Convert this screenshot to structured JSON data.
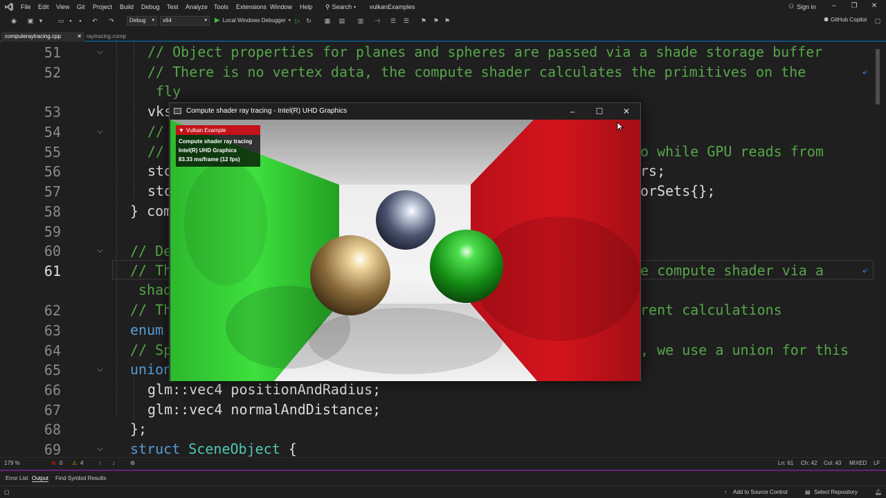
{
  "menubar": {
    "items": [
      "File",
      "Edit",
      "View",
      "Git",
      "Project",
      "Build",
      "Debug",
      "Test",
      "Analyze",
      "Tools",
      "Extensions",
      "Window",
      "Help"
    ],
    "search_label": "Search",
    "solution_name": "vulkanExamples",
    "sign_in": "Sign in"
  },
  "toolbar": {
    "configuration": "Debug",
    "platform": "x64",
    "debugger_label": "Local Windows Debugger",
    "copilot_label": "GitHub Copilot"
  },
  "tabs": [
    {
      "label": "computeraytracing.cpp",
      "active": true
    },
    {
      "label": "raytracing.comp",
      "active": false
    }
  ],
  "editor": {
    "lines": [
      {
        "num": "51",
        "text": "// Object properties for planes and spheres are passed via a shade storage buffer"
      },
      {
        "num": "52",
        "text": "// There is no vertex data, the compute shader calculates the primitives on the"
      },
      {
        "num": "",
        "text": "fly"
      },
      {
        "num": "53",
        "text": "vks"
      },
      {
        "num": "54",
        "text": "//"
      },
      {
        "num": "55",
        "text": "//"
      },
      {
        "num": "56",
        "text": "sto"
      },
      {
        "num": "57",
        "text": "sto"
      },
      {
        "num": "58",
        "text": "} com"
      },
      {
        "num": "59",
        "text": ""
      },
      {
        "num": "60",
        "text": "// De"
      },
      {
        "num": "61",
        "text": "// Th"
      },
      {
        "num": "",
        "text": "shad"
      },
      {
        "num": "62",
        "text": "// Th"
      },
      {
        "num": "63",
        "text": "enum "
      },
      {
        "num": "64",
        "text": "// Sp"
      },
      {
        "num": "65",
        "text": "union"
      },
      {
        "num": "66",
        "text": "glm::vec4 positionAndRadius;"
      },
      {
        "num": "67",
        "text": "glm::vec4 normalAndDistance;"
      },
      {
        "num": "68",
        "text": "};"
      },
      {
        "num": "69",
        "text": "struct SceneObject {"
      }
    ],
    "right_fragments": {
      "line55": "o while GPU reads from",
      "line56": "rs;",
      "line57": "orSets{};",
      "line61": "e compute shader via a",
      "line62": "rent calculations",
      "line64": ", we use a union for this"
    },
    "current_line": "61"
  },
  "editor_status": {
    "zoom": "179 %",
    "errors": "0",
    "warnings": "4",
    "line": "Ln: 61",
    "char": "Ch: 42",
    "col": "Col: 43",
    "encoding": "MIXED",
    "eol": "LF"
  },
  "panel_tabs": [
    "Error List",
    "Output",
    "Find Symbol Results"
  ],
  "statusbar": {
    "source_control": "Add to Source Control",
    "repository": "Select Repository"
  },
  "vulkan_window": {
    "title": "Compute shader ray tracing - Intel(R) UHD Graphics",
    "overlay": {
      "header": "Vulkan Example",
      "line1": "Compute shader ray tracing",
      "line2": "Intel(R) UHD Graphics",
      "line3": "83.33 ms/frame (12 fps)"
    }
  },
  "colors": {
    "comment": "#57a64a",
    "keyword": "#569cd6",
    "type": "#4ec9b0",
    "accent": "#007acc",
    "overlay_header": "#c4131a"
  }
}
